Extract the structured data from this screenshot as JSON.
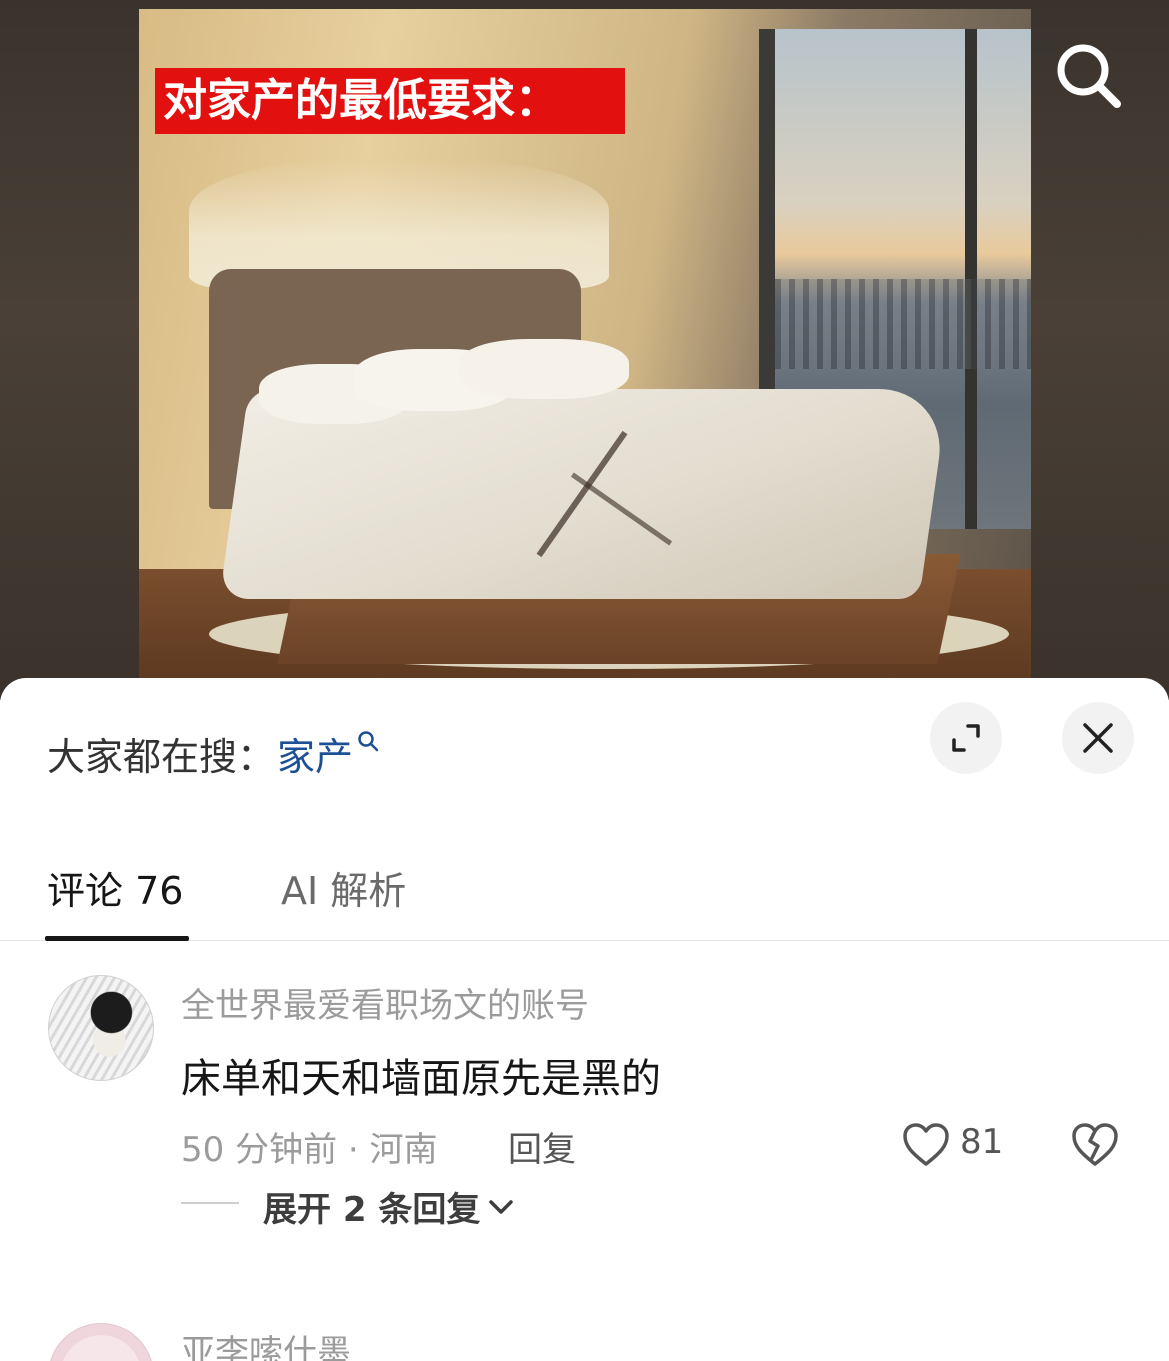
{
  "media": {
    "caption": "对家产的最低要求："
  },
  "sheet": {
    "trending_label": "大家都在搜：",
    "trending_keyword": "家产",
    "tabs": [
      {
        "label": "评论 76",
        "active": true
      },
      {
        "label": "AI 解析",
        "active": false
      }
    ]
  },
  "comments": [
    {
      "username": "全世界最爱看职场文的账号",
      "text": "床单和天和墙面原先是黑的",
      "time_location": "50 分钟前 · 河南",
      "reply_label": "回复",
      "likes": "81",
      "expand_label": "展开 2 条回复"
    },
    {
      "username": "亚李嗦什墨"
    }
  ],
  "colors": {
    "banner": "#e31010",
    "keyword": "#1d4f96",
    "text_primary": "#161616",
    "text_secondary": "#9b9b9b"
  }
}
